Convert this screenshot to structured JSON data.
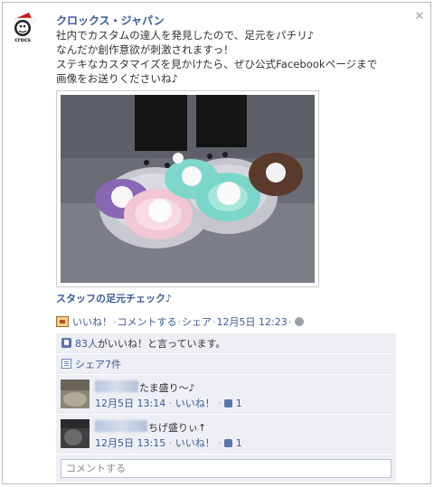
{
  "post": {
    "author": "クロックス・ジャパン",
    "lines": [
      "社内でカスタムの達人を発見したので、足元をパチリ♪",
      "なんだか創作意欲が刺激されますっ！",
      "ステキなカスタマイズを見かけたら、ぜひ公式Facebookページまで",
      "画像をお送りくださいね♪"
    ],
    "caption": "スタッフの足元チェック♪"
  },
  "actions": {
    "like": "いいね！",
    "comment": "コメントする",
    "share": "シェア",
    "timestamp": "12月5日 12:23",
    "dot": "·"
  },
  "likes": {
    "count_link": "83人",
    "suffix": "がいいね！と言っています。"
  },
  "shares": {
    "label": "シェア7件"
  },
  "comments": [
    {
      "text": "たま盛り～♪",
      "time": "12月5日 13:14",
      "like": "いいね！",
      "like_count": "1"
    },
    {
      "text": "ちげ盛りぃ↑",
      "time": "12月5日 13:15",
      "like": "いいね！",
      "like_count": "1"
    }
  ],
  "comment_input": {
    "placeholder": "コメントする"
  },
  "icons": {
    "close": "close-icon",
    "globe": "globe-icon",
    "like": "thumbs-up-icon",
    "share": "share-icon",
    "photo": "photo-icon"
  },
  "colors": {
    "link": "#3b5998",
    "ufi_bg": "#edeff4",
    "meta": "#999999"
  }
}
